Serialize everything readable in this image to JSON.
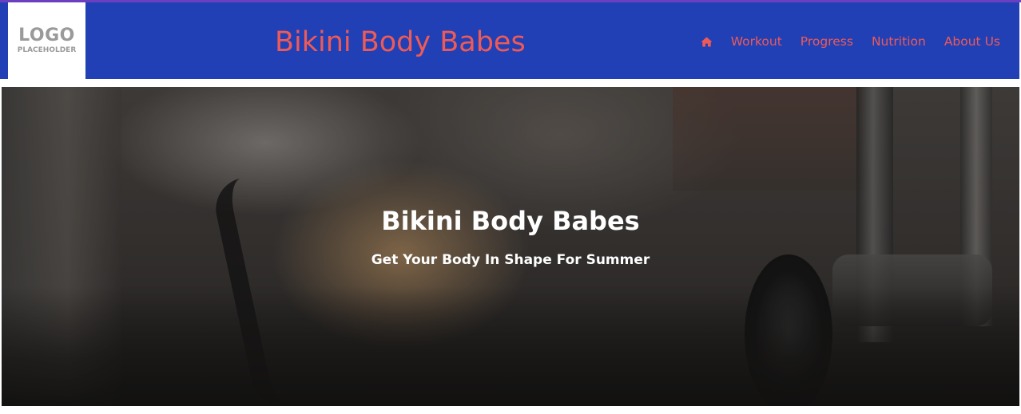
{
  "colors": {
    "navbar": "#2140b6",
    "accent_text": "#ee5a57",
    "top_accent": "#6a3fc0",
    "hero_text": "#ffffff"
  },
  "logo": {
    "main": "LOGO",
    "sub": "PLACEHOLDER"
  },
  "header": {
    "brand": "Bikini Body Babes"
  },
  "nav": {
    "home_icon": "home-icon",
    "items": [
      {
        "label": "Workout"
      },
      {
        "label": "Progress"
      },
      {
        "label": "Nutrition"
      },
      {
        "label": "About Us"
      }
    ]
  },
  "hero": {
    "title": "Bikini Body Babes",
    "subtitle": "Get Your Body In Shape For Summer"
  }
}
